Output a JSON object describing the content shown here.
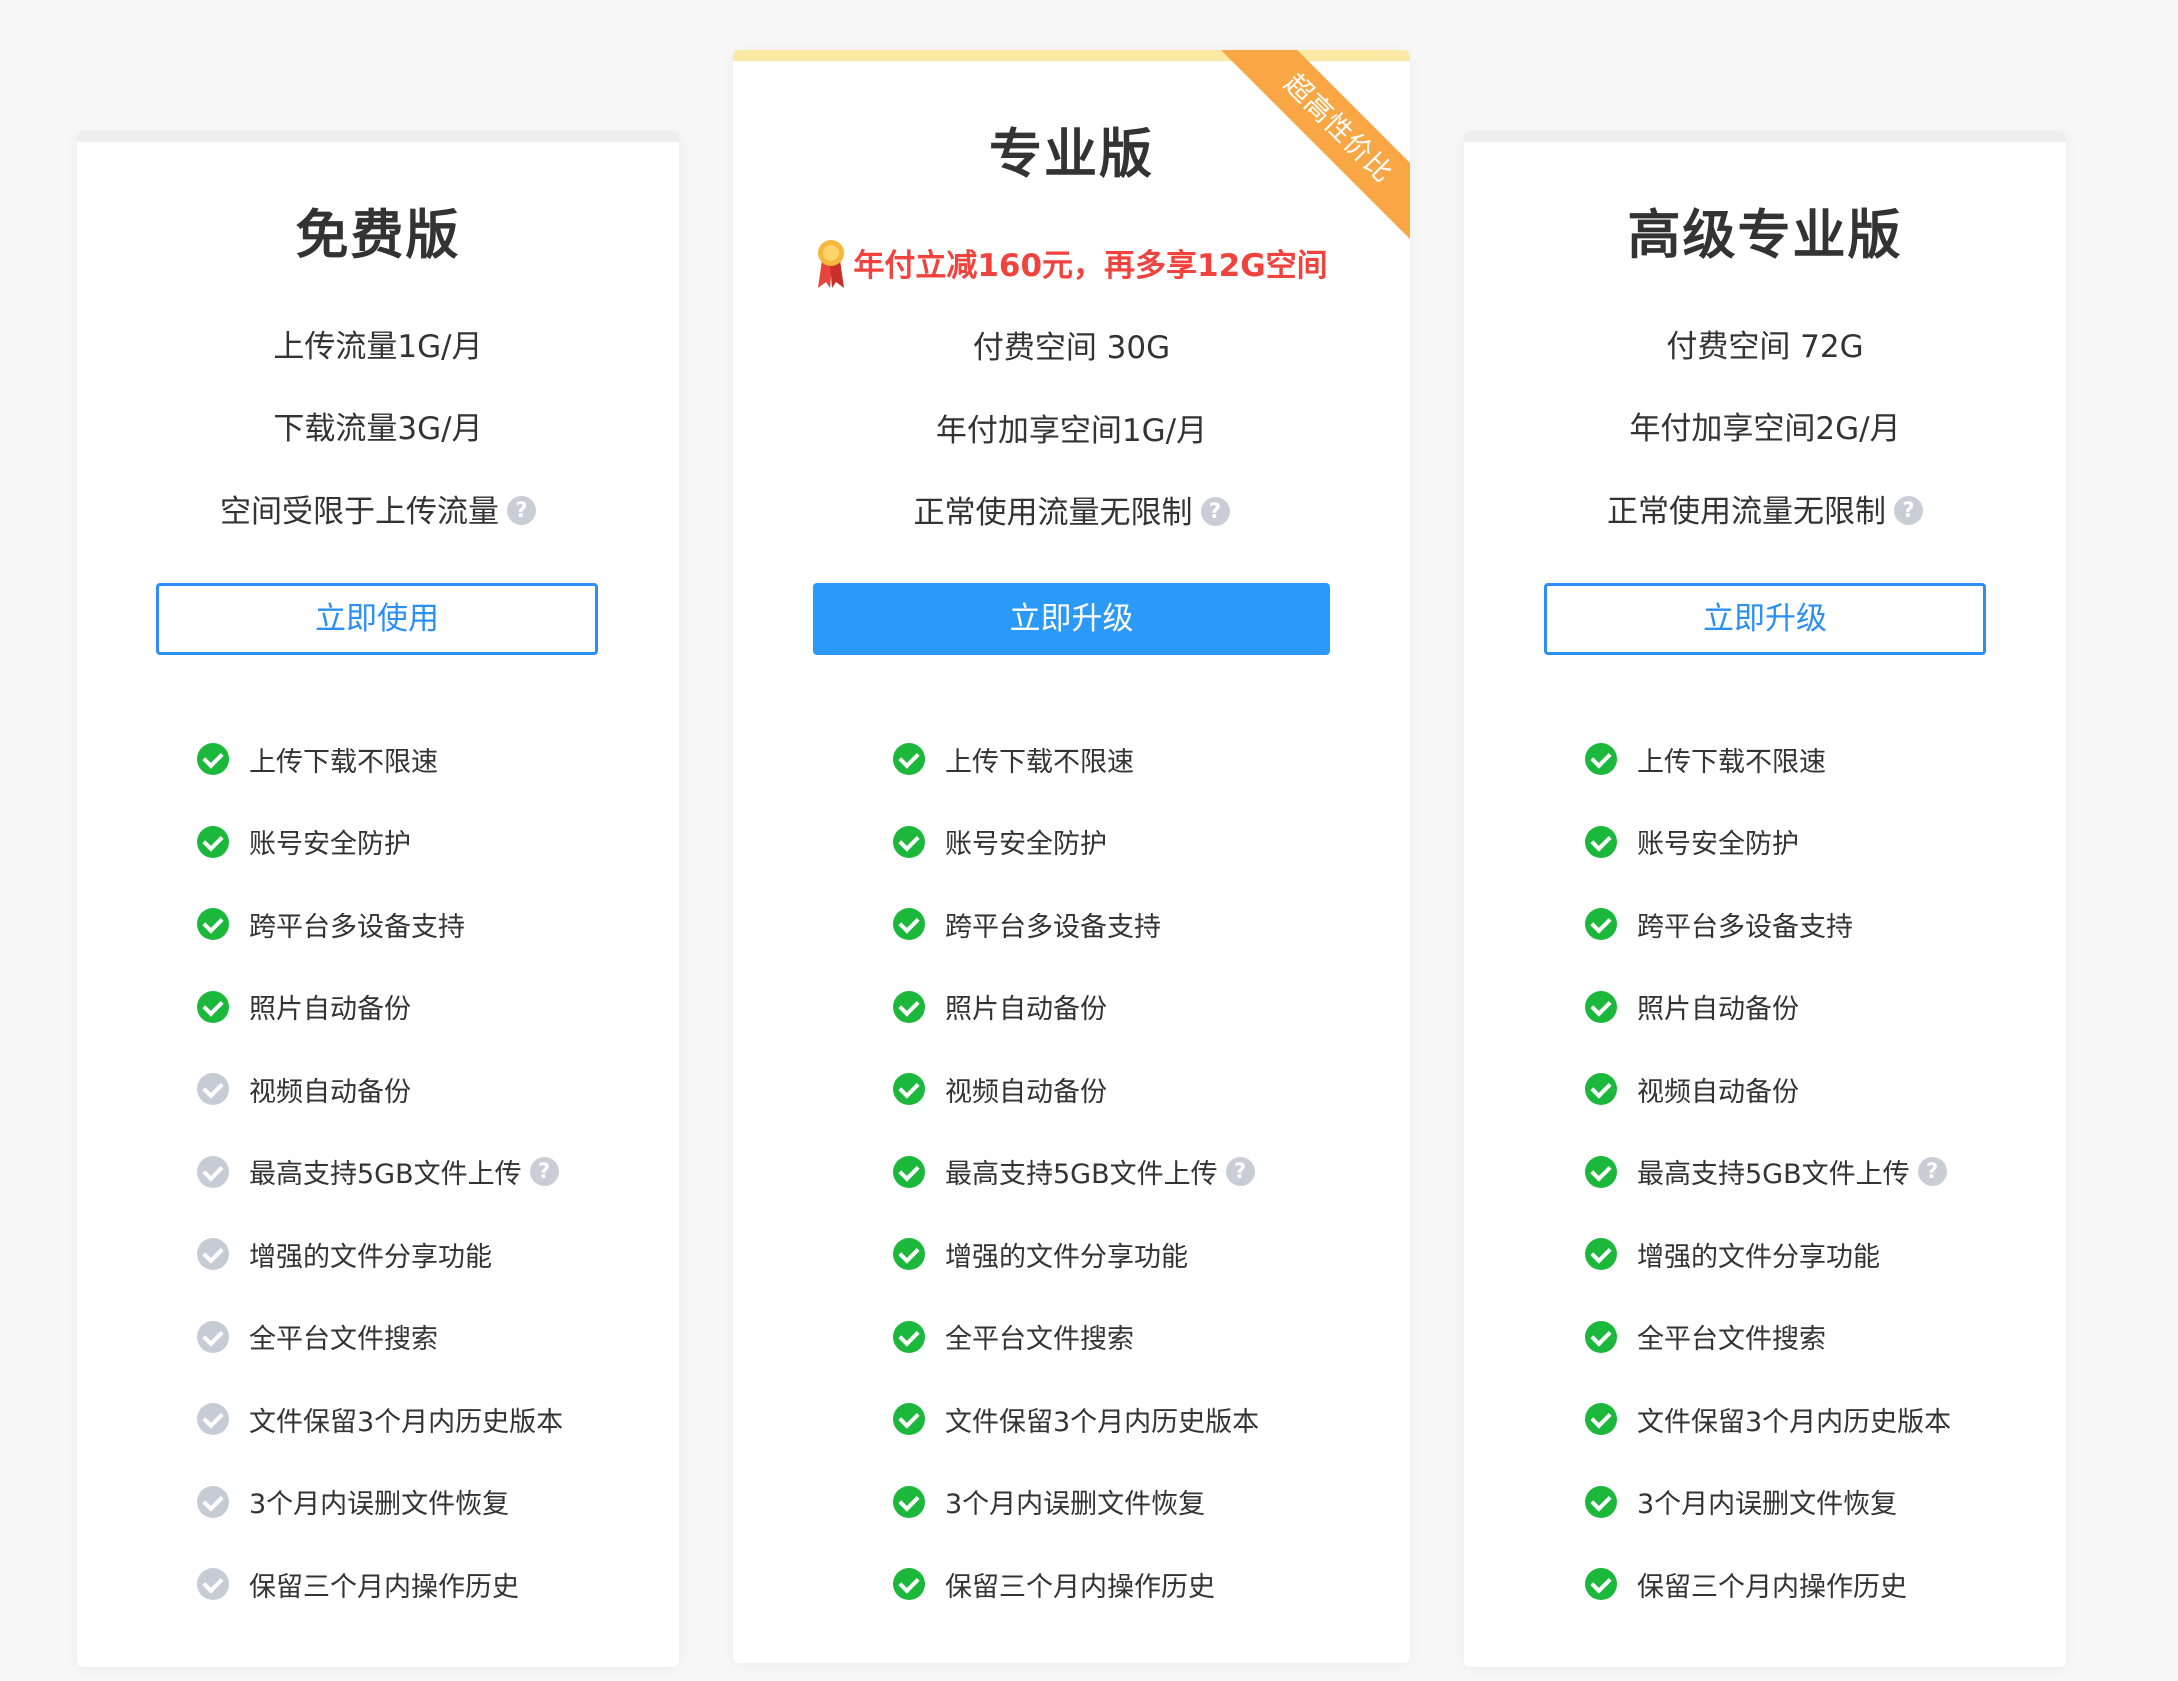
{
  "plans": {
    "free": {
      "title": "免费版",
      "specs": [
        "上传流量1G/月",
        "下载流量3G/月",
        "空间受限于上传流量"
      ],
      "button": "立即使用",
      "features": [
        {
          "label": "上传下载不限速",
          "included": true
        },
        {
          "label": "账号安全防护",
          "included": true
        },
        {
          "label": "跨平台多设备支持",
          "included": true
        },
        {
          "label": "照片自动备份",
          "included": true
        },
        {
          "label": "视频自动备份",
          "included": false
        },
        {
          "label": "最高支持5GB文件上传",
          "included": false,
          "help": true
        },
        {
          "label": "增强的文件分享功能",
          "included": false
        },
        {
          "label": "全平台文件搜索",
          "included": false
        },
        {
          "label": "文件保留3个月内历史版本",
          "included": false
        },
        {
          "label": "3个月内误删文件恢复",
          "included": false
        },
        {
          "label": "保留三个月内操作历史",
          "included": false
        }
      ]
    },
    "pro": {
      "title": "专业版",
      "ribbon": "超高性价比",
      "promo": "年付立减160元，再多享12G空间",
      "specs": [
        "付费空间 30G",
        "年付加享空间1G/月",
        "正常使用流量无限制"
      ],
      "button": "立即升级",
      "features": [
        {
          "label": "上传下载不限速",
          "included": true
        },
        {
          "label": "账号安全防护",
          "included": true
        },
        {
          "label": "跨平台多设备支持",
          "included": true
        },
        {
          "label": "照片自动备份",
          "included": true
        },
        {
          "label": "视频自动备份",
          "included": true
        },
        {
          "label": "最高支持5GB文件上传",
          "included": true,
          "help": true
        },
        {
          "label": "增强的文件分享功能",
          "included": true
        },
        {
          "label": "全平台文件搜索",
          "included": true
        },
        {
          "label": "文件保留3个月内历史版本",
          "included": true
        },
        {
          "label": "3个月内误删文件恢复",
          "included": true
        },
        {
          "label": "保留三个月内操作历史",
          "included": true
        }
      ]
    },
    "premium": {
      "title": "高级专业版",
      "specs": [
        "付费空间 72G",
        "年付加享空间2G/月",
        "正常使用流量无限制"
      ],
      "button": "立即升级",
      "features": [
        {
          "label": "上传下载不限速",
          "included": true
        },
        {
          "label": "账号安全防护",
          "included": true
        },
        {
          "label": "跨平台多设备支持",
          "included": true
        },
        {
          "label": "照片自动备份",
          "included": true
        },
        {
          "label": "视频自动备份",
          "included": true
        },
        {
          "label": "最高支持5GB文件上传",
          "included": true,
          "help": true
        },
        {
          "label": "增强的文件分享功能",
          "included": true
        },
        {
          "label": "全平台文件搜索",
          "included": true
        },
        {
          "label": "文件保留3个月内历史版本",
          "included": true
        },
        {
          "label": "3个月内误删文件恢复",
          "included": true
        },
        {
          "label": "保留三个月内操作历史",
          "included": true
        }
      ]
    }
  },
  "help_glyph": "?",
  "icons": {
    "check": "check-circle-icon",
    "help": "question-circle-icon",
    "medal": "medal-icon"
  },
  "colors": {
    "accent": "#2b99f7",
    "check_on": "#1bb83c",
    "check_off": "#c6ccd5",
    "promo": "#f0433e",
    "ribbon": "#f8a744",
    "pro_topbar": "#fde9a6"
  }
}
